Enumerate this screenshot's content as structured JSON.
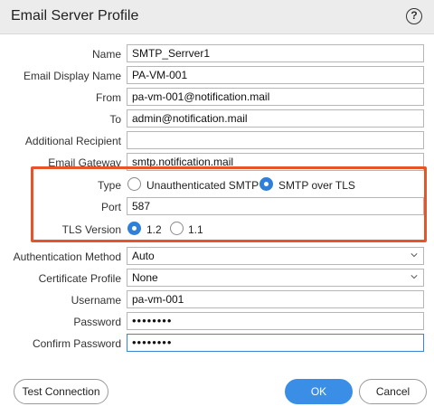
{
  "dialog": {
    "title": "Email Server Profile",
    "help_icon": "?"
  },
  "fields": {
    "name": {
      "label": "Name",
      "value": "SMTP_Serrver1"
    },
    "display_name": {
      "label": "Email Display Name",
      "value": "PA-VM-001"
    },
    "from": {
      "label": "From",
      "value": "pa-vm-001@notification.mail"
    },
    "to": {
      "label": "To",
      "value": "admin@notification.mail"
    },
    "additional_recipient": {
      "label": "Additional Recipient",
      "value": ""
    },
    "gateway": {
      "label": "Email Gateway",
      "value": "smtp.notification.mail"
    },
    "type": {
      "label": "Type",
      "options": [
        "Unauthenticated SMTP",
        "SMTP over TLS"
      ],
      "selected": "SMTP over TLS"
    },
    "port": {
      "label": "Port",
      "value": "587"
    },
    "tls_version": {
      "label": "TLS Version",
      "options": [
        "1.2",
        "1.1"
      ],
      "selected": "1.2"
    },
    "auth_method": {
      "label": "Authentication Method",
      "value": "Auto"
    },
    "cert_profile": {
      "label": "Certificate Profile",
      "value": "None"
    },
    "username": {
      "label": "Username",
      "value": "pa-vm-001"
    },
    "password": {
      "label": "Password",
      "value": "••••••••"
    },
    "confirm_password": {
      "label": "Confirm Password",
      "value": "••••••••"
    }
  },
  "buttons": {
    "test_connection": "Test Connection",
    "ok": "OK",
    "cancel": "Cancel"
  },
  "colors": {
    "highlight": "#e8542a",
    "accent": "#3a8ee6",
    "header_bg": "#ececec"
  }
}
